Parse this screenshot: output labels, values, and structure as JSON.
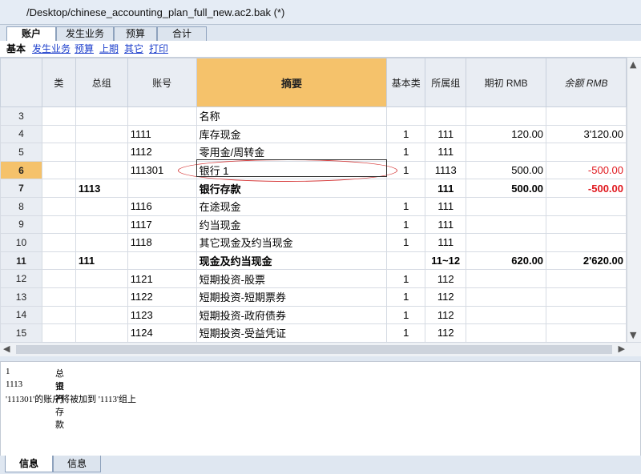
{
  "window": {
    "title": "/Desktop/chinese_accounting_plan_full_new.ac2.bak (*)"
  },
  "tabs": [
    {
      "label": "账户"
    },
    {
      "label": "发生业务"
    },
    {
      "label": "预算"
    },
    {
      "label": "合计"
    }
  ],
  "views": {
    "current": "基本",
    "links": [
      "发生业务",
      "预算",
      "上期",
      "其它",
      "打印"
    ]
  },
  "table": {
    "columns": [
      "",
      "类",
      "总组",
      "账号",
      "摘要",
      "基本类",
      "所属组",
      "期初 RMB",
      "余额 RMB"
    ],
    "rows": [
      {
        "n": "3",
        "cls": "",
        "grp": "",
        "acct": "",
        "desc": "名称",
        "base": "",
        "belong": "",
        "open": "",
        "bal": ""
      },
      {
        "n": "4",
        "cls": "",
        "grp": "",
        "acct": "1111",
        "desc": "库存现金",
        "base": "1",
        "belong": "111",
        "open": "120.00",
        "bal": "3'120.00"
      },
      {
        "n": "5",
        "cls": "",
        "grp": "",
        "acct": "1112",
        "desc": "零用金/周转金",
        "base": "1",
        "belong": "111",
        "open": "",
        "bal": ""
      },
      {
        "n": "6",
        "cls": "",
        "grp": "",
        "acct": "111301",
        "desc": "银行 1",
        "base": "1",
        "belong": "1113",
        "open": "500.00",
        "bal": "-500.00"
      },
      {
        "n": "7",
        "cls": "",
        "grp": "1113",
        "acct": "",
        "desc": "银行存款",
        "base": "",
        "belong": "111",
        "open": "500.00",
        "bal": "-500.00"
      },
      {
        "n": "8",
        "cls": "",
        "grp": "",
        "acct": "1116",
        "desc": "在途现金",
        "base": "1",
        "belong": "111",
        "open": "",
        "bal": ""
      },
      {
        "n": "9",
        "cls": "",
        "grp": "",
        "acct": "1117",
        "desc": "约当现金",
        "base": "1",
        "belong": "111",
        "open": "",
        "bal": ""
      },
      {
        "n": "10",
        "cls": "",
        "grp": "",
        "acct": "1118",
        "desc": "其它现金及约当现金",
        "base": "1",
        "belong": "111",
        "open": "",
        "bal": ""
      },
      {
        "n": "11",
        "cls": "",
        "grp": "111",
        "acct": "",
        "desc": "现金及约当现金",
        "base": "",
        "belong": "11~12",
        "open": "620.00",
        "bal": "2'620.00"
      },
      {
        "n": "12",
        "cls": "",
        "grp": "",
        "acct": "1121",
        "desc": "短期投资-股票",
        "base": "1",
        "belong": "112",
        "open": "",
        "bal": ""
      },
      {
        "n": "13",
        "cls": "",
        "grp": "",
        "acct": "1122",
        "desc": "短期投资-短期票券",
        "base": "1",
        "belong": "112",
        "open": "",
        "bal": ""
      },
      {
        "n": "14",
        "cls": "",
        "grp": "",
        "acct": "1123",
        "desc": "短期投资-政府债券",
        "base": "1",
        "belong": "112",
        "open": "",
        "bal": ""
      },
      {
        "n": "15",
        "cls": "",
        "grp": "",
        "acct": "1124",
        "desc": "短期投资-受益凭证",
        "base": "1",
        "belong": "112",
        "open": "",
        "bal": ""
      }
    ]
  },
  "info": {
    "lines": [
      {
        "a": "1",
        "b": "总资产"
      },
      {
        "a": "1113",
        "b": "银行存款"
      },
      {
        "a": "'111301'的账户将被加到 '1113'组上",
        "b": ""
      }
    ]
  },
  "bottom_tabs": [
    {
      "label": "信息"
    },
    {
      "label": "信息"
    }
  ],
  "colors": {
    "selected_header": "#f5c26b",
    "negative": "#e0191f",
    "link": "#1d3fcc"
  }
}
